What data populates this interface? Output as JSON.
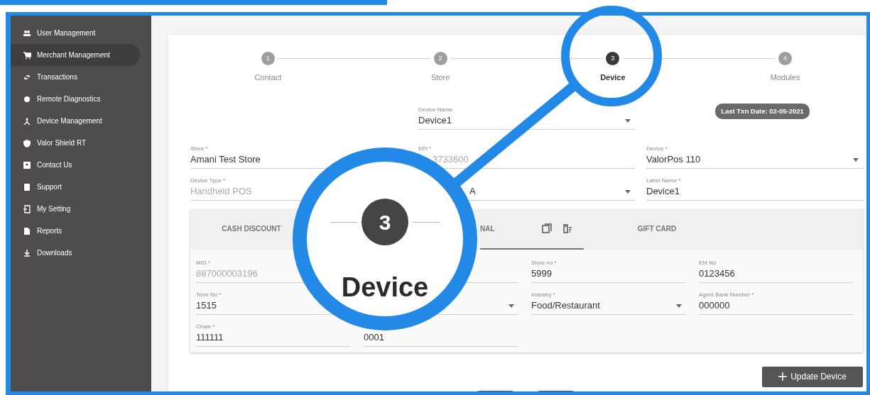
{
  "sidebar": {
    "items": [
      {
        "label": "User Management",
        "selected": false
      },
      {
        "label": "Merchant Management",
        "selected": true
      },
      {
        "label": "Transactions",
        "selected": false
      },
      {
        "label": "Remote Diagnostics",
        "selected": false
      },
      {
        "label": "Device Management",
        "selected": false
      },
      {
        "label": "Valor Shield RT",
        "selected": false
      },
      {
        "label": "Contact Us",
        "selected": false
      },
      {
        "label": "Support",
        "selected": false
      },
      {
        "label": "My Setting",
        "selected": false
      },
      {
        "label": "Reports",
        "selected": false
      },
      {
        "label": "Downloads",
        "selected": false
      }
    ]
  },
  "steps": [
    {
      "number": "1",
      "label": "Contact",
      "selected": false
    },
    {
      "number": "2",
      "label": "Store",
      "selected": false
    },
    {
      "number": "3",
      "label": "Device",
      "selected": true
    },
    {
      "number": "4",
      "label": "Modules",
      "selected": false
    }
  ],
  "device_name": {
    "label": "Device Name",
    "value": "Device1",
    "dropdown": true
  },
  "badge": "Last Txn Date: 02-05-2021",
  "field_rows": [
    [
      {
        "label": "Store *",
        "value": "Amani Test Store"
      },
      {
        "label": "EPI *",
        "value": "3733600",
        "disabled": true
      },
      {
        "label": "Device *",
        "value": "ValorPos 110",
        "dropdown": true
      }
    ],
    [
      {
        "label": "Device Type *",
        "value": "Handheld POS",
        "disabled": true
      },
      {
        "value": "A",
        "dropdown": true
      },
      {
        "label": "Label Name *",
        "value": "Device1"
      }
    ]
  ],
  "tabs": [
    {
      "label": "CASH DISCOUNT",
      "selected": false
    },
    {
      "label": "NAL",
      "selected": true
    },
    {
      "label": "GIFT CARD",
      "selected": false
    }
  ],
  "tab_fields": [
    {
      "column_1": {
        "label": "MID *",
        "value": "887000003196",
        "disabled": true
      },
      "column_3": {
        "label": "Store no *",
        "value": "5999"
      },
      "column_4": {
        "label": "Ebt No",
        "value": "0123456"
      }
    },
    {
      "column_1": {
        "label": "Term No *",
        "value": "1515"
      },
      "column_2": {
        "dropdown": true
      },
      "column_3": {
        "label": "Industry *",
        "value": "Food/Restaurant",
        "dropdown": true
      },
      "column_4": {
        "label": "Agent Bank Number *",
        "value": "000000"
      }
    },
    {
      "column_1": {
        "label": "Chain *",
        "value": "111111"
      },
      "column_2": {
        "value": "0001"
      }
    }
  ],
  "update_button": "Update Device",
  "magnifier": {
    "number": "3",
    "label": "Device"
  }
}
